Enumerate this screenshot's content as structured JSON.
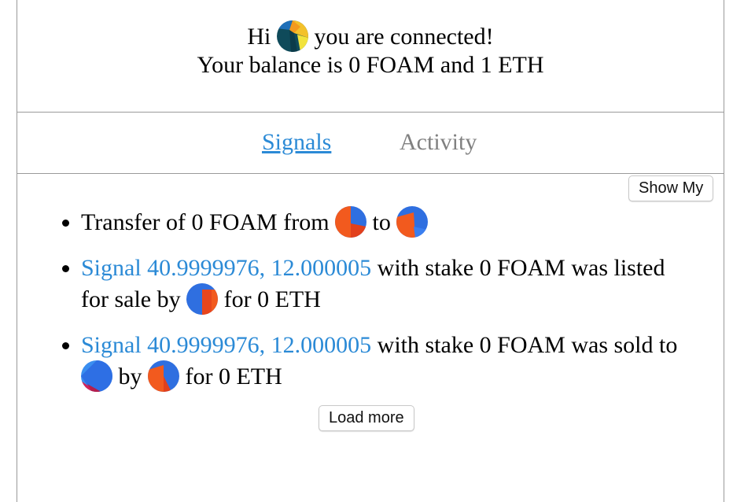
{
  "header": {
    "greet_before": "Hi",
    "greet_after": "you are connected!",
    "balance": "Your balance is 0 FOAM and 1 ETH"
  },
  "tabs": [
    {
      "label": "Signals",
      "active": true
    },
    {
      "label": "Activity",
      "active": false
    }
  ],
  "show_my_label": "Show My",
  "feed": [
    {
      "kind": "transfer",
      "t1": "Transfer of 0 FOAM from",
      "t2": "to"
    },
    {
      "kind": "listing",
      "signal": "Signal 40.9999976, 12.000005",
      "t1": "with stake 0 FOAM was listed for sale by",
      "t2": "for 0 ETH"
    },
    {
      "kind": "sale",
      "signal": "Signal 40.9999976, 12.000005",
      "t1": "with stake 0 FOAM was sold to",
      "t2": "by",
      "t3": "for 0 ETH"
    }
  ],
  "load_more_label": "Load more",
  "colors": {
    "link": "#2b8ad6",
    "inactive_tab": "#808080",
    "border": "#9a9a9a"
  },
  "icons": {
    "connected_avatar": "identicon-avatar",
    "address_avatar": "identicon-avatar"
  }
}
